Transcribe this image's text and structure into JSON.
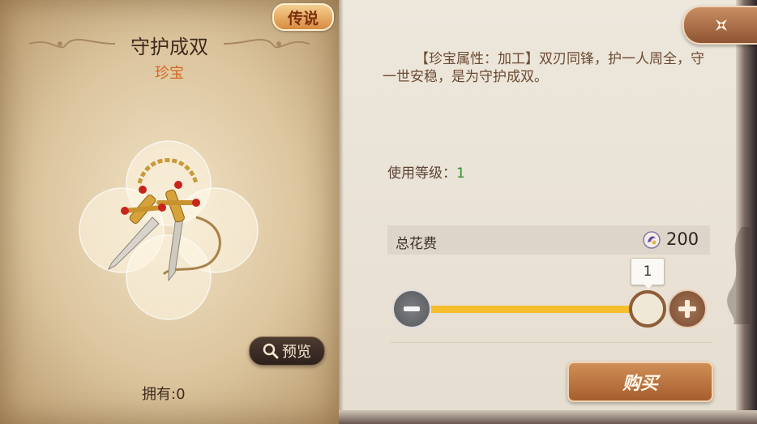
{
  "item": {
    "rarity": "传说",
    "name": "守护成双",
    "type": "珍宝",
    "preview_label": "预览",
    "owned_text": "拥有:0"
  },
  "details": {
    "description": "【珍宝属性：加工】双刃同锋，护一人周全，守一世安稳，是为守护成双。",
    "level_label": "使用等级：",
    "level_value": "1"
  },
  "purchase": {
    "cost_label": "总花费",
    "cost_value": "200",
    "currency_icon": "gem-coin-icon",
    "quantity": "1",
    "buy_label": "购买"
  },
  "icons": {
    "close": "close-shuriken-icon",
    "search": "search-icon",
    "minus": "minus-icon",
    "plus": "plus-icon"
  },
  "colors": {
    "type_text": "#d2651f",
    "level_value": "#2f8f2a",
    "slider_fill": "#f6bd2c",
    "button_brown": "#a75d2e"
  }
}
